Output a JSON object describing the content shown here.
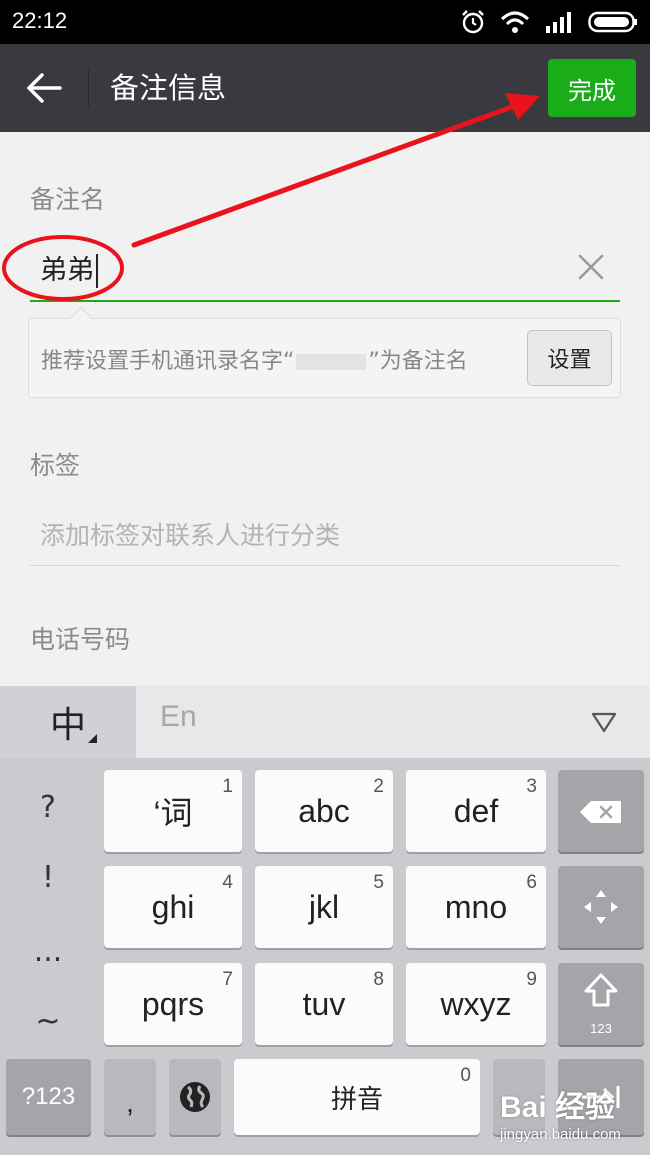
{
  "status_bar": {
    "time": "22:12",
    "icons": [
      "alarm-icon",
      "wifi-icon",
      "signal-icon",
      "battery-icon"
    ]
  },
  "title_bar": {
    "back_icon": "back-arrow-icon",
    "title": "备注信息",
    "done_label": "完成",
    "done_color": "#1aad19"
  },
  "form": {
    "remark_label": "备注名",
    "remark_value": "弟弟",
    "clear_icon": "close-icon",
    "suggestion": {
      "prefix": "推荐设置手机通讯录名字“",
      "suffix": "”为备注名",
      "button_label": "设置"
    },
    "tag_label": "标签",
    "tag_placeholder": "添加标签对联系人进行分类",
    "phone_label": "电话号码"
  },
  "keyboard": {
    "tab_zh": "中",
    "tab_en": "En",
    "collapse_icon": "collapse-triangle-icon",
    "symbols": [
      "?",
      "!",
      "...",
      "~"
    ],
    "keys": [
      {
        "label": "‘词",
        "num": "1"
      },
      {
        "label": "abc",
        "num": "2"
      },
      {
        "label": "def",
        "num": "3"
      },
      {
        "label": "ghi",
        "num": "4"
      },
      {
        "label": "jkl",
        "num": "5"
      },
      {
        "label": "mno",
        "num": "6"
      },
      {
        "label": "pqrs",
        "num": "7"
      },
      {
        "label": "tuv",
        "num": "8"
      },
      {
        "label": "wxyz",
        "num": "9"
      }
    ],
    "backspace_icon": "backspace-icon",
    "cursor_move_icon": "cursor-move-icon",
    "shift_icon": "shift-icon",
    "shift_sub": "123",
    "mode_key": "?123",
    "comma_key": ",",
    "globe_icon": "globe-icon",
    "space_label": "拼音",
    "space_num": "0",
    "enter_icon": "enter-tab-icon"
  },
  "watermark": {
    "logo": "Bai 经验",
    "url": "jingyan.baidu.com"
  },
  "annotation_color": "#e8131b"
}
